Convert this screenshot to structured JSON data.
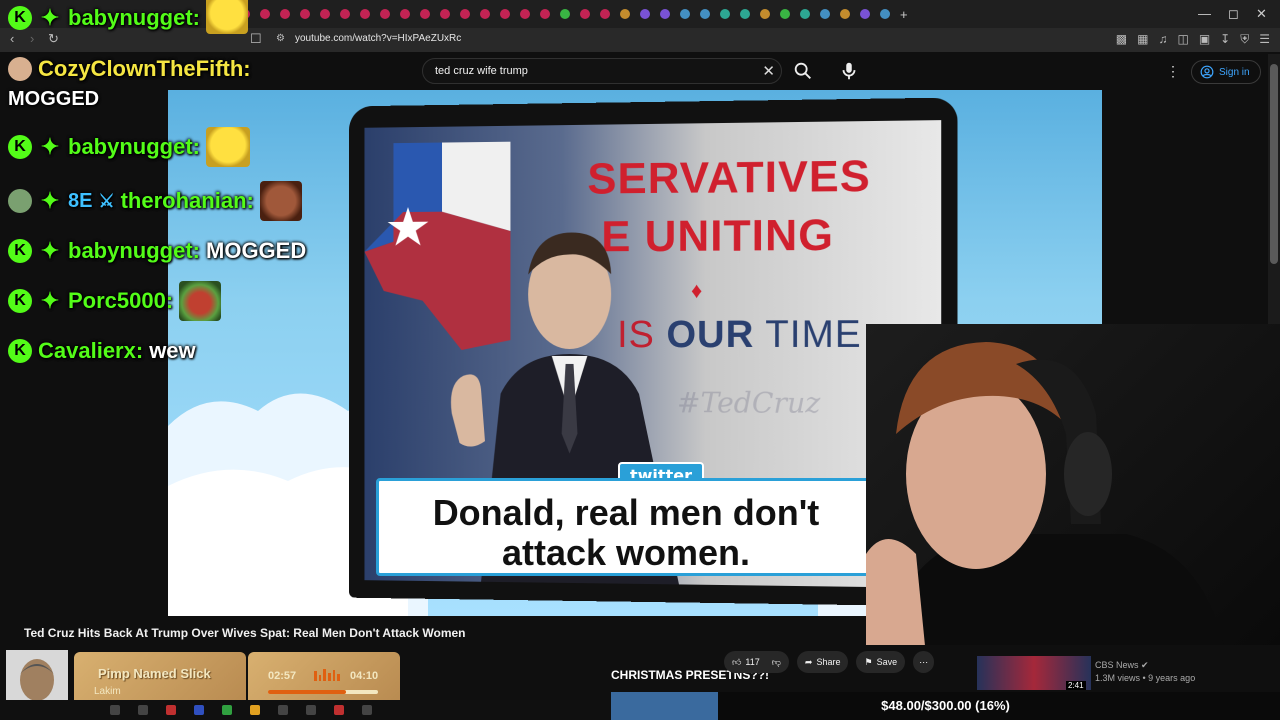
{
  "browser": {
    "url": "youtube.com/watch?v=HIxPAeZUxRc",
    "new_tab_glyph": "+",
    "window_controls": [
      "—",
      "◻",
      "✕"
    ]
  },
  "youtube": {
    "search_query": "ted cruz wife trump",
    "sign_in_label": "Sign in",
    "video_title": "Ted Cruz Hits Back At Trump Over Wives Spat: Real Men Don't Attack Women",
    "likes": "117",
    "share_label": "Share",
    "save_label": "Save",
    "recommended": {
      "channel": "CBS News",
      "meta": "1.3M views • 9 years ago",
      "duration": "2:41"
    }
  },
  "video_frame": {
    "slogan_line1": "SERVATIVES",
    "slogan_line2": "E UNITING",
    "slogan_line3_pre": "IS ",
    "slogan_line3_bold": "OUR",
    "slogan_line3_post": " TIME",
    "watermark": "#TedCruz",
    "twitter_tag": "twitter",
    "quote_line1": "Donald, real men don't",
    "quote_line2": "attack women."
  },
  "chat": {
    "top_overlay": "MOGGED",
    "messages": [
      {
        "user": "babynugget:",
        "text": "",
        "emote": "bee-emote"
      },
      {
        "user": "CozyClownTheFifth:",
        "text": "",
        "emote": ""
      },
      {
        "user": "babynugget:",
        "text": "",
        "emote": "bee-emote"
      },
      {
        "user": "therohanian:",
        "text": "",
        "emote": "face-emote",
        "badge_text": "8E"
      },
      {
        "user": "babynugget:",
        "text": "MOGGED",
        "emote": ""
      },
      {
        "user": "Porc5000:",
        "text": "",
        "emote": "pepe-emote"
      },
      {
        "user": "Cavalierx:",
        "text": "wew",
        "emote": ""
      }
    ]
  },
  "music": {
    "song": "Pimp Named Slick",
    "artist": "Lakim",
    "current": "02:57",
    "total": "04:10",
    "progress": 0.71
  },
  "stream_overlay": {
    "xmas_text": "CHRISTMAS PRESETNS??!",
    "goal_text": "$48.00/$300.00 (16%)",
    "goal_progress": 0.16
  },
  "colors": {
    "kick_green": "#53fc18",
    "yt_blue": "#3ea6ff"
  }
}
